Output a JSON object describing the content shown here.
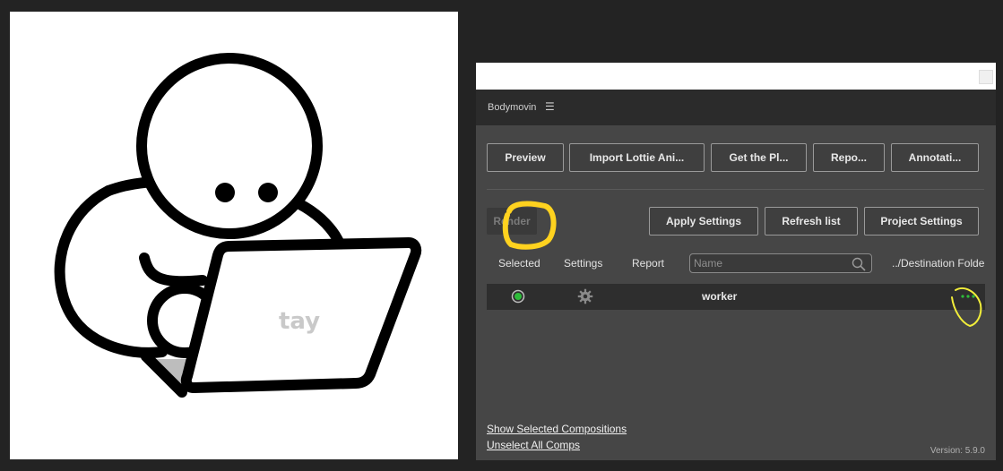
{
  "canvas": {
    "watermark": "tay"
  },
  "panel": {
    "title": "Bodymovin",
    "menu_icon": "hamburger-icon",
    "top_buttons": [
      {
        "label": "Preview"
      },
      {
        "label": "Import Lottie Ani..."
      },
      {
        "label": "Get the Pl..."
      },
      {
        "label": "Repo..."
      },
      {
        "label": "Annotati..."
      }
    ],
    "render_label": "Render",
    "actions": {
      "apply_settings": "Apply Settings",
      "refresh_list": "Refresh list",
      "project_settings": "Project Settings"
    },
    "columns": {
      "selected": "Selected",
      "settings": "Settings",
      "report": "Report",
      "destination": "../Destination Folde"
    },
    "search": {
      "placeholder": "Name"
    },
    "compositions": [
      {
        "name": "worker",
        "selected": true,
        "more": "..."
      }
    ],
    "links": {
      "show_selected": "Show Selected Compositions",
      "unselect_all": "Unselect All Comps"
    },
    "version": "Version: 5.9.0"
  },
  "colors": {
    "panel_bg": "#464646",
    "row_bg": "#2e2e2e",
    "selected_green": "#2ebd3a",
    "highlight_yellow": "#ffd21f",
    "annotation_yellow": "#f2ee3a"
  }
}
